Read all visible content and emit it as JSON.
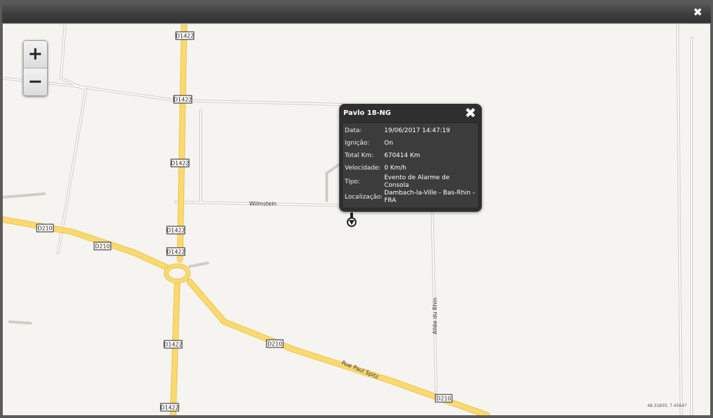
{
  "window": {
    "close_icon": "close-icon"
  },
  "zoom": {
    "in": "+",
    "out": "−"
  },
  "popup": {
    "title": "Pavlo 18-NG",
    "rows": [
      {
        "label": "Data:",
        "value": "19/06/2017 14:47:19"
      },
      {
        "label": "Ignição:",
        "value": "On"
      },
      {
        "label": "Total Km:",
        "value": "670414 Km"
      },
      {
        "label": "Velocidade:",
        "value": "0 Km/h"
      },
      {
        "label": "Tipo:",
        "value": "Evento de Alarme de Consola"
      },
      {
        "label": "Localização:",
        "value": "Dambach-la-Ville - Bas-Rhin - FRA"
      }
    ]
  },
  "map": {
    "road_labels": [
      "D1422",
      "D210",
      "Wilmstein",
      "Rue Paul Spitz",
      "Allée du Rhin"
    ],
    "marker_icon": "vehicle-marker-icon",
    "coordinates": "48.31835; 7.45647"
  },
  "colors": {
    "road_major": "#fbd96e",
    "road_minor_casing": "#d8d6d0",
    "map_background": "#f5f4f0",
    "popup_bg": "#2f2f2f"
  }
}
